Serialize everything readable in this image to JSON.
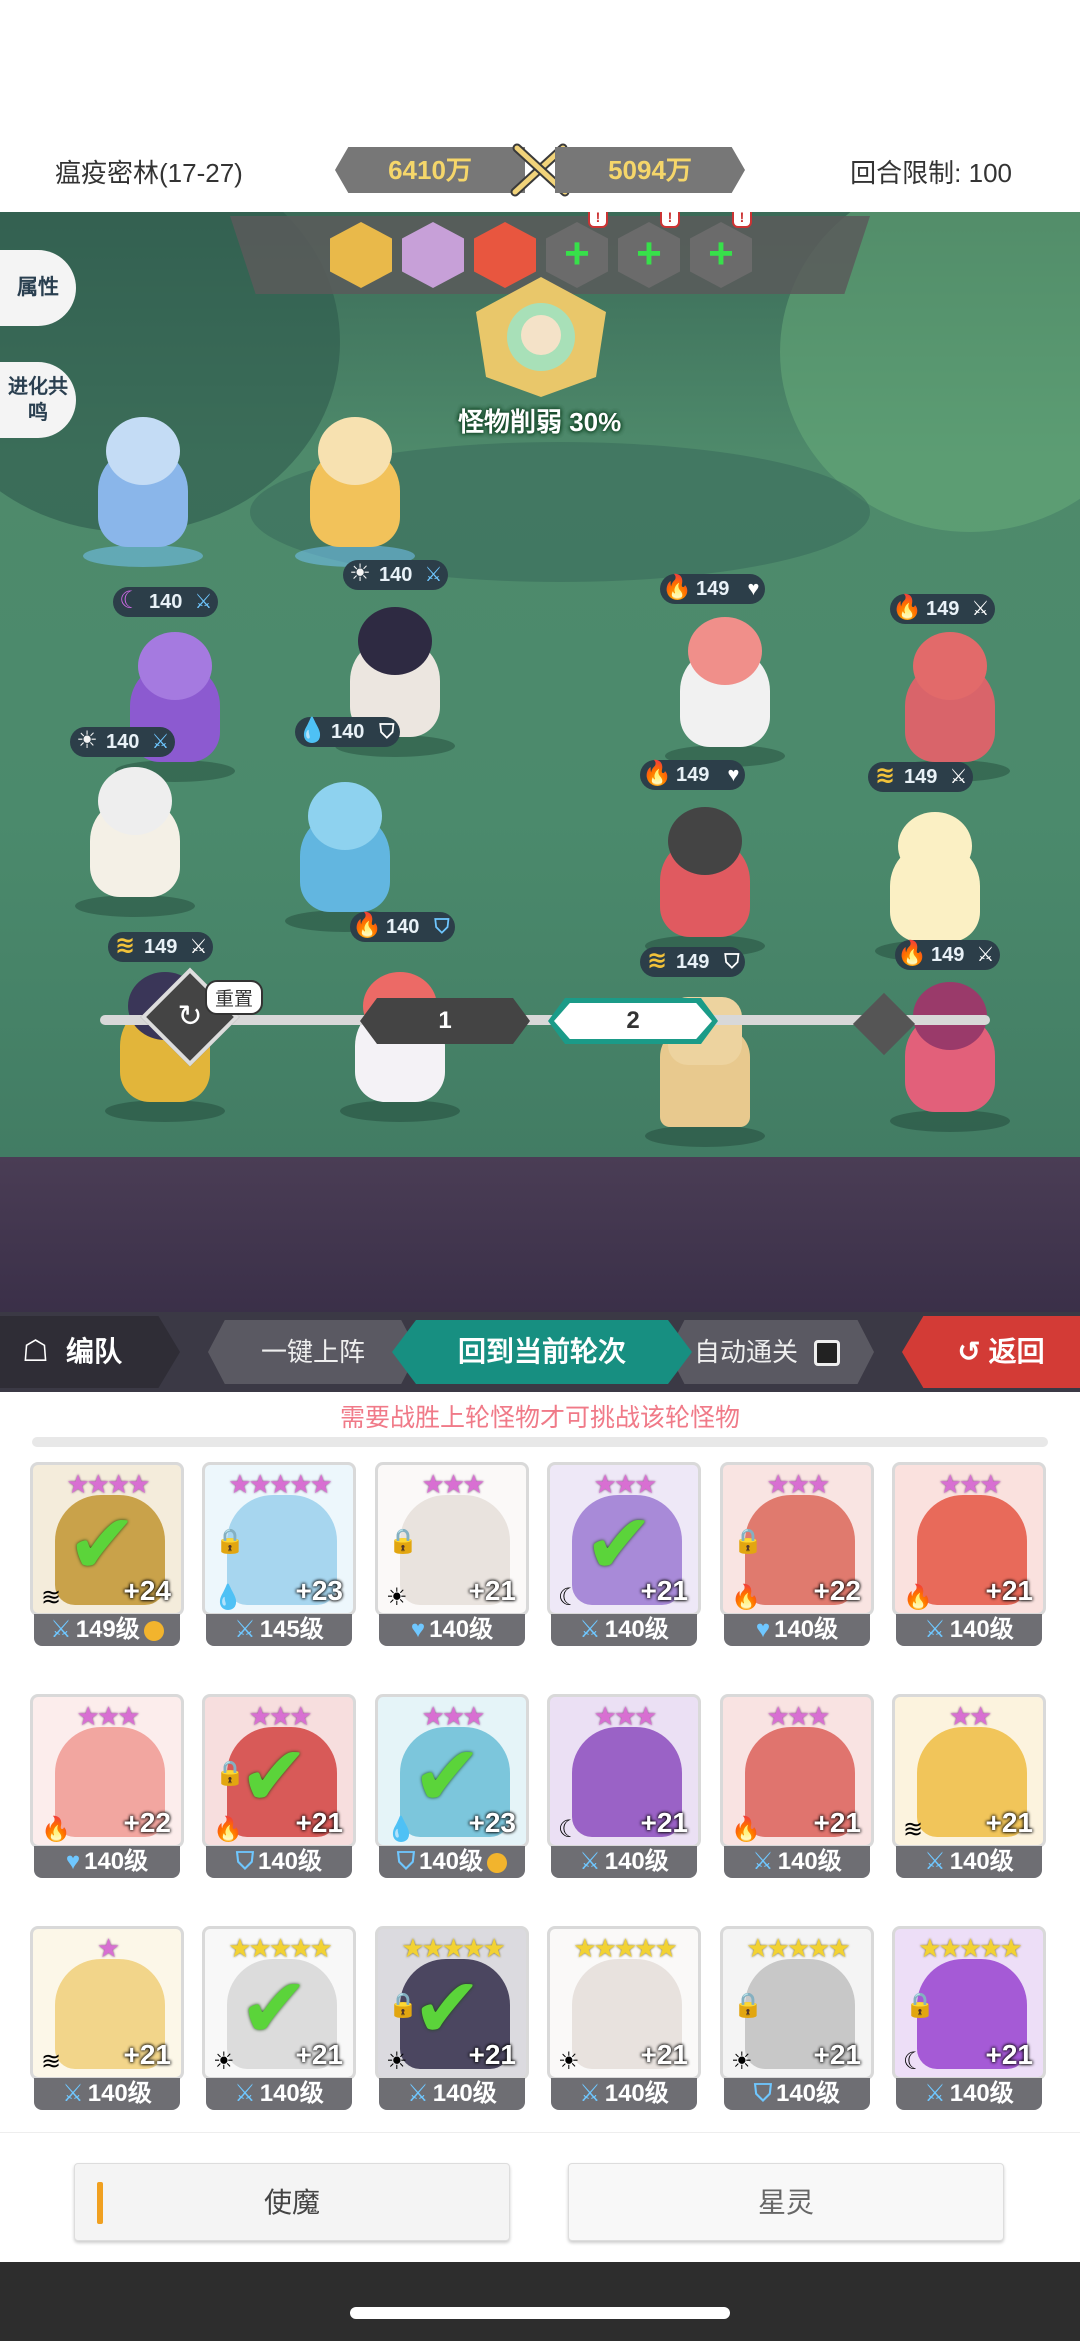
{
  "header": {
    "stage": "瘟疫密林(17-27)",
    "power_left": "6410万",
    "power_right": "5094万",
    "round_limit": "回合限制: 100"
  },
  "battle": {
    "attr_btn": "属性",
    "evolve_btn": "进化共鸣",
    "weaken_text": "怪物削弱 30%",
    "ally_levels": [
      "140",
      "140",
      "140",
      "140",
      "140",
      "149",
      "140"
    ],
    "enemy_levels": [
      "149",
      "149",
      "149",
      "149",
      "149",
      "149"
    ]
  },
  "wave": {
    "reset_label": "重置",
    "wave1": "1",
    "wave2": "2"
  },
  "tabs": {
    "team": "编队",
    "one_click": "一键上阵",
    "current_round": "回到当前轮次",
    "auto_clear": "自动通关",
    "back": "返回"
  },
  "notice": "需要战胜上轮怪物才可挑战该轮怪物",
  "cards": [
    {
      "stars": "★★★★",
      "star_color": "pink",
      "plus": "+24",
      "level": "149级",
      "checked": true,
      "locked": false,
      "mark": true,
      "face": "#c9a24a"
    },
    {
      "stars": "★★★★★",
      "star_color": "pink",
      "plus": "+23",
      "level": "145级",
      "checked": false,
      "locked": true,
      "mark": false,
      "face": "#a7d6ef"
    },
    {
      "stars": "★★★",
      "star_color": "pink",
      "plus": "+21",
      "level": "140级",
      "checked": false,
      "locked": true,
      "mark": false,
      "face": "#e9e3de"
    },
    {
      "stars": "★★★",
      "star_color": "pink",
      "plus": "+21",
      "level": "140级",
      "checked": true,
      "locked": false,
      "mark": false,
      "face": "#a88ad8"
    },
    {
      "stars": "★★★",
      "star_color": "pink",
      "plus": "+22",
      "level": "140级",
      "checked": false,
      "locked": true,
      "mark": false,
      "face": "#e07a6e"
    },
    {
      "stars": "★★★",
      "star_color": "pink",
      "plus": "+21",
      "level": "140级",
      "checked": false,
      "locked": false,
      "mark": false,
      "face": "#e86a5a"
    },
    {
      "stars": "★★★",
      "star_color": "pink",
      "plus": "+22",
      "level": "140级",
      "checked": false,
      "locked": false,
      "mark": false,
      "face": "#f2a6a0"
    },
    {
      "stars": "★★★",
      "star_color": "pink",
      "plus": "+21",
      "level": "140级",
      "checked": true,
      "locked": true,
      "mark": false,
      "face": "#d85a58"
    },
    {
      "stars": "★★★",
      "star_color": "pink",
      "plus": "+23",
      "level": "140级",
      "checked": true,
      "locked": false,
      "mark": true,
      "face": "#7cc6dc"
    },
    {
      "stars": "★★★",
      "star_color": "pink",
      "plus": "+21",
      "level": "140级",
      "checked": false,
      "locked": false,
      "mark": false,
      "face": "#9a62c6"
    },
    {
      "stars": "★★★",
      "star_color": "pink",
      "plus": "+21",
      "level": "140级",
      "checked": false,
      "locked": false,
      "mark": false,
      "face": "#e0746e"
    },
    {
      "stars": "★★",
      "star_color": "pink",
      "plus": "+21",
      "level": "140级",
      "checked": false,
      "locked": false,
      "mark": false,
      "face": "#f1c55a"
    },
    {
      "stars": "★",
      "star_color": "pink",
      "plus": "+21",
      "level": "140级",
      "checked": false,
      "locked": false,
      "mark": false,
      "face": "#f2d58a"
    },
    {
      "stars": "★★★★★",
      "star_color": "gold",
      "plus": "+21",
      "level": "140级",
      "checked": true,
      "locked": false,
      "mark": false,
      "face": "#dcdcdc"
    },
    {
      "stars": "★★★★★",
      "star_color": "gold",
      "plus": "+21",
      "level": "140级",
      "checked": true,
      "locked": true,
      "mark": false,
      "face": "#4b4660"
    },
    {
      "stars": "★★★★★",
      "star_color": "gold",
      "plus": "+21",
      "level": "140级",
      "checked": false,
      "locked": false,
      "mark": false,
      "face": "#e8e2de"
    },
    {
      "stars": "★★★★★",
      "star_color": "gold",
      "plus": "+21",
      "level": "140级",
      "checked": false,
      "locked": true,
      "mark": false,
      "face": "#c8c8c8"
    },
    {
      "stars": "★★★★★",
      "star_color": "gold",
      "plus": "+21",
      "level": "140级",
      "checked": false,
      "locked": true,
      "mark": false,
      "face": "#a55ad6"
    }
  ],
  "bottom_tabs": {
    "left": "使魔",
    "right": "星灵"
  }
}
